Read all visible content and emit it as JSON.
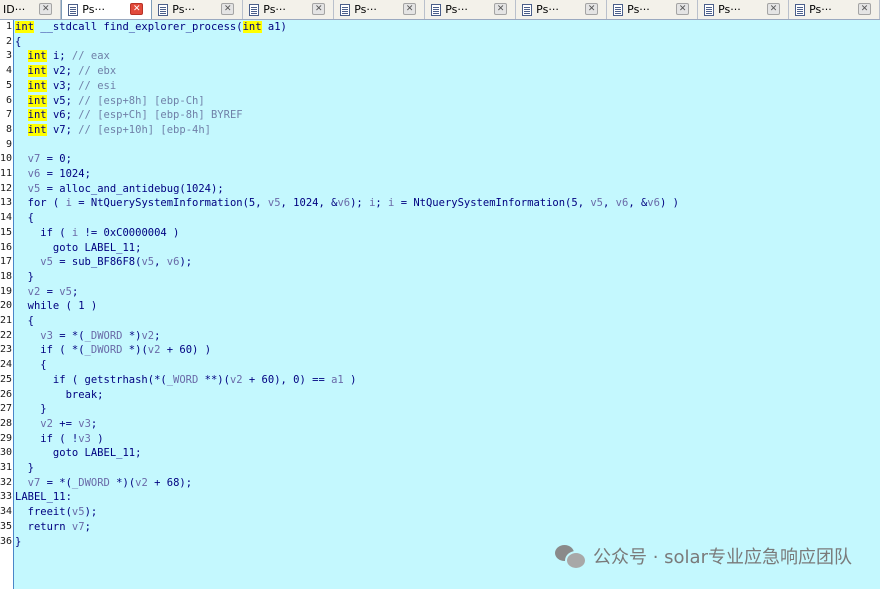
{
  "tabs": [
    {
      "label": "ID···",
      "active": false,
      "first": true
    },
    {
      "label": "Ps···",
      "active": true
    },
    {
      "label": "Ps···",
      "active": false
    },
    {
      "label": "Ps···",
      "active": false
    },
    {
      "label": "Ps···",
      "active": false
    },
    {
      "label": "Ps···",
      "active": false
    },
    {
      "label": "Ps···",
      "active": false
    },
    {
      "label": "Ps···",
      "active": false
    },
    {
      "label": "Ps···",
      "active": false
    },
    {
      "label": "Ps···",
      "active": false
    }
  ],
  "code_lines": [
    [
      [
        "kw",
        "int"
      ],
      [
        "t",
        " __stdcall find_explorer_process("
      ],
      [
        "kw",
        "int"
      ],
      [
        "t",
        " a1)"
      ]
    ],
    [
      [
        "t",
        "{"
      ]
    ],
    [
      [
        "t",
        "  "
      ],
      [
        "kw",
        "int"
      ],
      [
        "t",
        " i; "
      ],
      [
        "cm",
        "// eax"
      ]
    ],
    [
      [
        "t",
        "  "
      ],
      [
        "kw",
        "int"
      ],
      [
        "t",
        " v2; "
      ],
      [
        "cm",
        "// ebx"
      ]
    ],
    [
      [
        "t",
        "  "
      ],
      [
        "kw",
        "int"
      ],
      [
        "t",
        " v3; "
      ],
      [
        "cm",
        "// esi"
      ]
    ],
    [
      [
        "t",
        "  "
      ],
      [
        "kw",
        "int"
      ],
      [
        "t",
        " v5; "
      ],
      [
        "cm",
        "// [esp+8h] [ebp-Ch]"
      ]
    ],
    [
      [
        "t",
        "  "
      ],
      [
        "kw",
        "int"
      ],
      [
        "t",
        " v6; "
      ],
      [
        "cm",
        "// [esp+Ch] [ebp-8h] BYREF"
      ]
    ],
    [
      [
        "t",
        "  "
      ],
      [
        "kw",
        "int"
      ],
      [
        "t",
        " v7; "
      ],
      [
        "cm",
        "// [esp+10h] [ebp-4h]"
      ]
    ],
    [
      [
        "t",
        ""
      ]
    ],
    [
      [
        "t",
        "  "
      ],
      [
        "v",
        "v7"
      ],
      [
        "t",
        " = 0;"
      ]
    ],
    [
      [
        "t",
        "  "
      ],
      [
        "v",
        "v6"
      ],
      [
        "t",
        " = 1024;"
      ]
    ],
    [
      [
        "t",
        "  "
      ],
      [
        "v",
        "v5"
      ],
      [
        "t",
        " = alloc_and_antidebug(1024);"
      ]
    ],
    [
      [
        "t",
        "  for ( "
      ],
      [
        "v",
        "i"
      ],
      [
        "t",
        " = NtQuerySystemInformation(5, "
      ],
      [
        "v",
        "v5"
      ],
      [
        "t",
        ", 1024, &"
      ],
      [
        "v",
        "v6"
      ],
      [
        "t",
        "); "
      ],
      [
        "v",
        "i"
      ],
      [
        "t",
        "; "
      ],
      [
        "v",
        "i"
      ],
      [
        "t",
        " = NtQuerySystemInformation(5, "
      ],
      [
        "v",
        "v5"
      ],
      [
        "t",
        ", "
      ],
      [
        "v",
        "v6"
      ],
      [
        "t",
        ", &"
      ],
      [
        "v",
        "v6"
      ],
      [
        "t",
        ") )"
      ]
    ],
    [
      [
        "t",
        "  {"
      ]
    ],
    [
      [
        "t",
        "    if ( "
      ],
      [
        "v",
        "i"
      ],
      [
        "t",
        " != 0xC0000004 )"
      ]
    ],
    [
      [
        "t",
        "      goto LABEL_11;"
      ]
    ],
    [
      [
        "t",
        "    "
      ],
      [
        "v",
        "v5"
      ],
      [
        "t",
        " = sub_BF86F8("
      ],
      [
        "v",
        "v5"
      ],
      [
        "t",
        ", "
      ],
      [
        "v",
        "v6"
      ],
      [
        "t",
        ");"
      ]
    ],
    [
      [
        "t",
        "  }"
      ]
    ],
    [
      [
        "t",
        "  "
      ],
      [
        "v",
        "v2"
      ],
      [
        "t",
        " = "
      ],
      [
        "v",
        "v5"
      ],
      [
        "t",
        ";"
      ]
    ],
    [
      [
        "t",
        "  while ( 1 )"
      ]
    ],
    [
      [
        "t",
        "  {"
      ]
    ],
    [
      [
        "t",
        "    "
      ],
      [
        "v",
        "v3"
      ],
      [
        "t",
        " = *("
      ],
      [
        "v",
        "_DWORD"
      ],
      [
        "t",
        " *)"
      ],
      [
        "v",
        "v2"
      ],
      [
        "t",
        ";"
      ]
    ],
    [
      [
        "t",
        "    if ( *("
      ],
      [
        "v",
        "_DWORD"
      ],
      [
        "t",
        " *)("
      ],
      [
        "v",
        "v2"
      ],
      [
        "t",
        " + 60) )"
      ]
    ],
    [
      [
        "t",
        "    {"
      ]
    ],
    [
      [
        "t",
        "      if ( getstrhash(*("
      ],
      [
        "v",
        "_WORD"
      ],
      [
        "t",
        " **)("
      ],
      [
        "v",
        "v2"
      ],
      [
        "t",
        " + 60), 0) == "
      ],
      [
        "v",
        "a1"
      ],
      [
        "t",
        " )"
      ]
    ],
    [
      [
        "t",
        "        break;"
      ]
    ],
    [
      [
        "t",
        "    }"
      ]
    ],
    [
      [
        "t",
        "    "
      ],
      [
        "v",
        "v2"
      ],
      [
        "t",
        " += "
      ],
      [
        "v",
        "v3"
      ],
      [
        "t",
        ";"
      ]
    ],
    [
      [
        "t",
        "    if ( !"
      ],
      [
        "v",
        "v3"
      ],
      [
        "t",
        " )"
      ]
    ],
    [
      [
        "t",
        "      goto LABEL_11;"
      ]
    ],
    [
      [
        "t",
        "  }"
      ]
    ],
    [
      [
        "t",
        "  "
      ],
      [
        "v",
        "v7"
      ],
      [
        "t",
        " = *("
      ],
      [
        "v",
        "_DWORD"
      ],
      [
        "t",
        " *)("
      ],
      [
        "v",
        "v2"
      ],
      [
        "t",
        " + 68);"
      ]
    ],
    [
      [
        "t",
        "LABEL_11:"
      ]
    ],
    [
      [
        "t",
        "  freeit("
      ],
      [
        "v",
        "v5"
      ],
      [
        "t",
        ");"
      ]
    ],
    [
      [
        "t",
        "  return "
      ],
      [
        "v",
        "v7"
      ],
      [
        "t",
        ";"
      ]
    ],
    [
      [
        "t",
        "}"
      ]
    ]
  ],
  "watermark": {
    "text": "公众号 · solar专业应急响应团队",
    "icon": "wechat-icon"
  }
}
